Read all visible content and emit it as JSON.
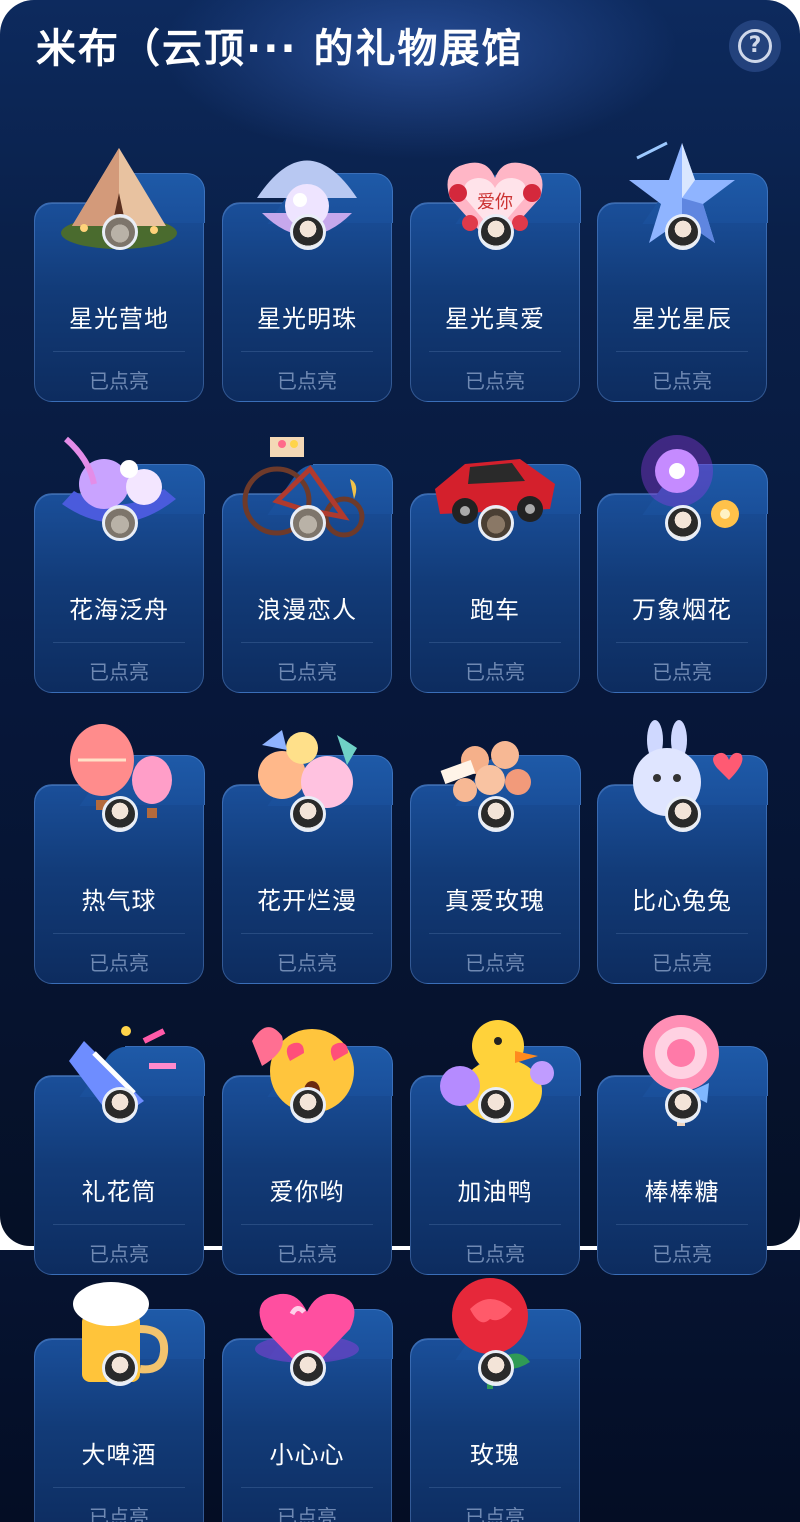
{
  "header": {
    "title": "米布（云顶··· 的礼物展馆",
    "help_icon": "question-circle-icon"
  },
  "status_label": "已点亮",
  "gifts": [
    {
      "name": "星光营地",
      "art_icon": "tent-camp-icon",
      "avatar": "cat"
    },
    {
      "name": "星光明珠",
      "art_icon": "pearl-shell-icon",
      "avatar": "girl"
    },
    {
      "name": "星光真爱",
      "art_icon": "heart-cake-icon",
      "avatar": "girl"
    },
    {
      "name": "星光星辰",
      "art_icon": "crystal-star-icon",
      "avatar": "girl"
    },
    {
      "name": "花海泛舟",
      "art_icon": "flower-boat-icon",
      "avatar": "cat"
    },
    {
      "name": "浪漫恋人",
      "art_icon": "bicycle-icon",
      "avatar": "cat"
    },
    {
      "name": "跑车",
      "art_icon": "sports-car-icon",
      "avatar": "car"
    },
    {
      "name": "万象烟花",
      "art_icon": "fireworks-icon",
      "avatar": "girl"
    },
    {
      "name": "热气球",
      "art_icon": "hot-air-balloon-icon",
      "avatar": "girl"
    },
    {
      "name": "花开烂漫",
      "art_icon": "flower-bouquet-icon",
      "avatar": "girl"
    },
    {
      "name": "真爱玫瑰",
      "art_icon": "rose-bouquet-icon",
      "avatar": "girl"
    },
    {
      "name": "比心兔兔",
      "art_icon": "bunny-heart-icon",
      "avatar": "girl"
    },
    {
      "name": "礼花筒",
      "art_icon": "party-popper-icon",
      "avatar": "girl"
    },
    {
      "name": "爱你哟",
      "art_icon": "heart-eyes-emoji-icon",
      "avatar": "girl"
    },
    {
      "name": "加油鸭",
      "art_icon": "cheer-duck-icon",
      "avatar": "girl"
    },
    {
      "name": "棒棒糖",
      "art_icon": "lollipop-icon",
      "avatar": "girl"
    },
    {
      "name": "大啤酒",
      "art_icon": "beer-mug-icon",
      "avatar": "girl"
    },
    {
      "name": "小心心",
      "art_icon": "glowing-heart-icon",
      "avatar": "girl"
    },
    {
      "name": "玫瑰",
      "art_icon": "red-rose-icon",
      "avatar": "girl"
    }
  ],
  "colors": {
    "background_top": "#0d2a5e",
    "background_bottom": "#040d24",
    "card_fill": "#123b78",
    "status_text": "#6f89b3",
    "title_text": "#ffffff"
  }
}
